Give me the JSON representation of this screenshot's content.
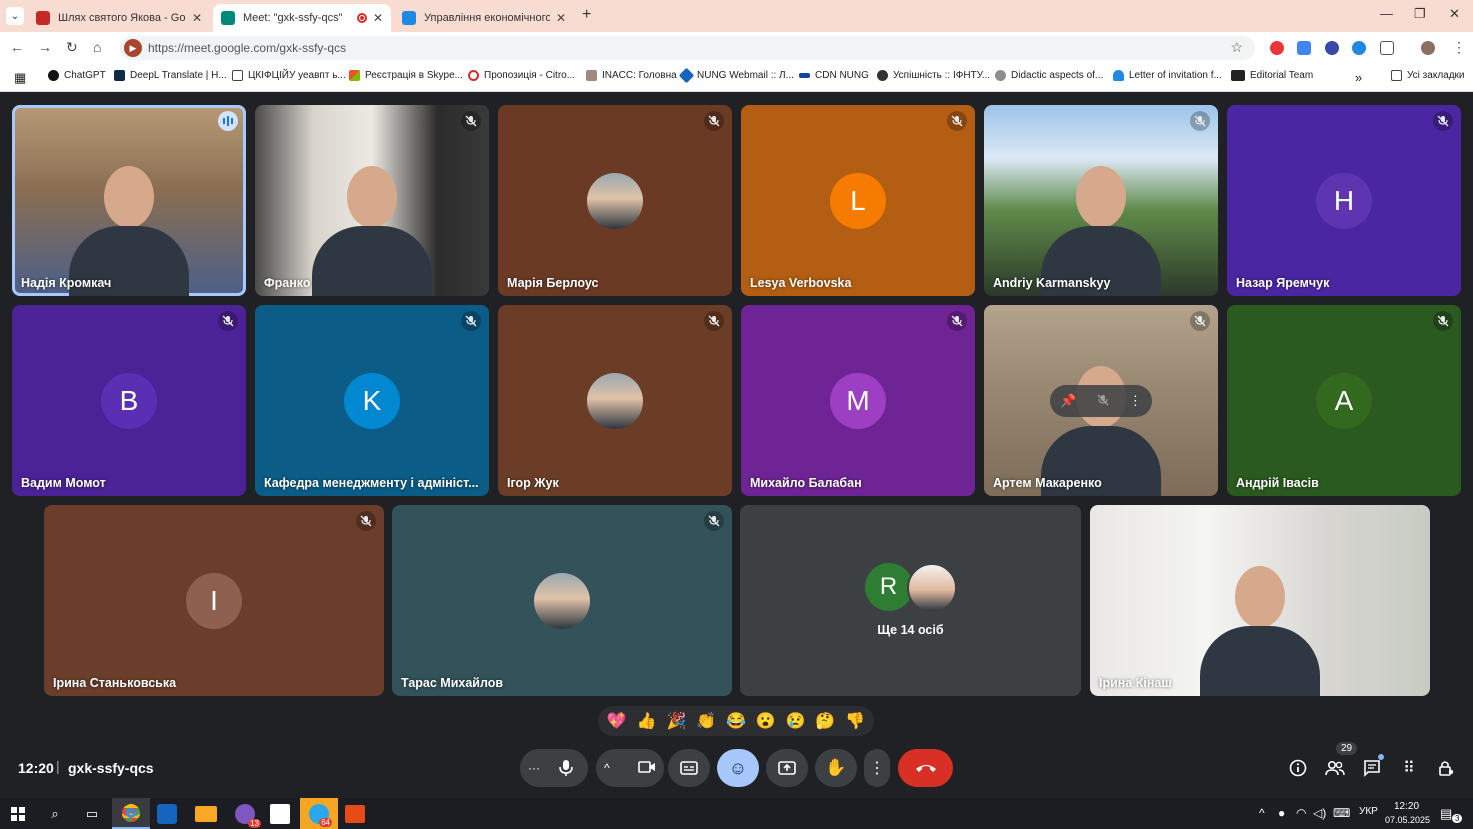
{
  "browser": {
    "tabs": [
      {
        "title": "Шлях святого Якова - Gorgany",
        "active": false,
        "favicon_color": "#c62828"
      },
      {
        "title": "Meet: \"gxk-ssfy-qcs\"",
        "active": true,
        "favicon_color": "#00897b"
      },
      {
        "title": "Управління економічного роз",
        "active": false,
        "favicon_color": "#1e88e5"
      }
    ],
    "url": "https://meet.google.com/gxk-ssfy-qcs",
    "bookmarks": [
      "ChatGPT",
      "DeepL Translate | H...",
      "ЦКІФЦІЙУ уеавпт ь...",
      "Реєстрація в Skype...",
      "Пропозиція - Citro...",
      "INACC: Головна",
      "NUNG Webmail :: Л...",
      "CDN NUNG",
      "Успішність :: ІФНТУ...",
      "Didactic aspects of...",
      "Letter of invitation f...",
      "Editorial Team"
    ],
    "bookmarks_all": "Усі закладки"
  },
  "participants": [
    {
      "name": "Надія Кромкач",
      "type": "video",
      "speaking": true
    },
    {
      "name": "Франко",
      "type": "video"
    },
    {
      "name": "Марія Берлоус",
      "type": "photo",
      "bg": "#6b3a25"
    },
    {
      "name": "Lesya Verbovska",
      "type": "letter",
      "letter": "L",
      "bg": "#b35e12",
      "avatar_color": "#f57c00"
    },
    {
      "name": "Andriy Karmanskyy",
      "type": "video"
    },
    {
      "name": "Назар Яремчук",
      "type": "letter",
      "letter": "H",
      "bg": "#4a26a3",
      "avatar_color": "#5e35b1"
    },
    {
      "name": "Вадим Момот",
      "type": "letter",
      "letter": "B",
      "bg": "#4b2396",
      "avatar_color": "#5b2fb3"
    },
    {
      "name": "Кафедра менеджменту і адмініст...",
      "type": "letter",
      "letter": "K",
      "bg": "#0b5c86",
      "avatar_color": "#0288d1"
    },
    {
      "name": "Ігор Жук",
      "type": "photo",
      "bg": "#6b3d27"
    },
    {
      "name": "Михайло Балабан",
      "type": "letter",
      "letter": "M",
      "bg": "#6e2494",
      "avatar_color": "#9c3fc2"
    },
    {
      "name": "Артем Макаренко",
      "type": "video"
    },
    {
      "name": "Андрій Івасів",
      "type": "letter",
      "letter": "A",
      "bg": "#2a5a20",
      "avatar_color": "#33691e"
    },
    {
      "name": "Ірина Станьковська",
      "type": "letter",
      "letter": "I",
      "bg": "#6a3e2a",
      "avatar_color": "#8d6050"
    },
    {
      "name": "Тарас Михайлов",
      "type": "photo",
      "bg": "#33525a"
    },
    {
      "name": "Ще 14 осіб",
      "type": "more",
      "letter": "R"
    },
    {
      "name": "Ірина Кінаш",
      "type": "video"
    }
  ],
  "reactions": [
    "💖",
    "👍",
    "🎉",
    "👏",
    "😂",
    "😮",
    "😢",
    "🤔",
    "👎"
  ],
  "controls": {
    "time": "12:20",
    "meeting_code": "gxk-ssfy-qcs",
    "participant_count": "29"
  },
  "taskbar": {
    "language": "УКР",
    "time": "12:20",
    "date": "07.05.2025",
    "messenger_badge": "13",
    "telegram_badge": "64",
    "notification_count": "3"
  },
  "colors": {
    "meet_bg": "#202124",
    "tab_bar": "#f9dcd1",
    "end_call": "#d93025",
    "active_control": "#a8c7fa"
  }
}
